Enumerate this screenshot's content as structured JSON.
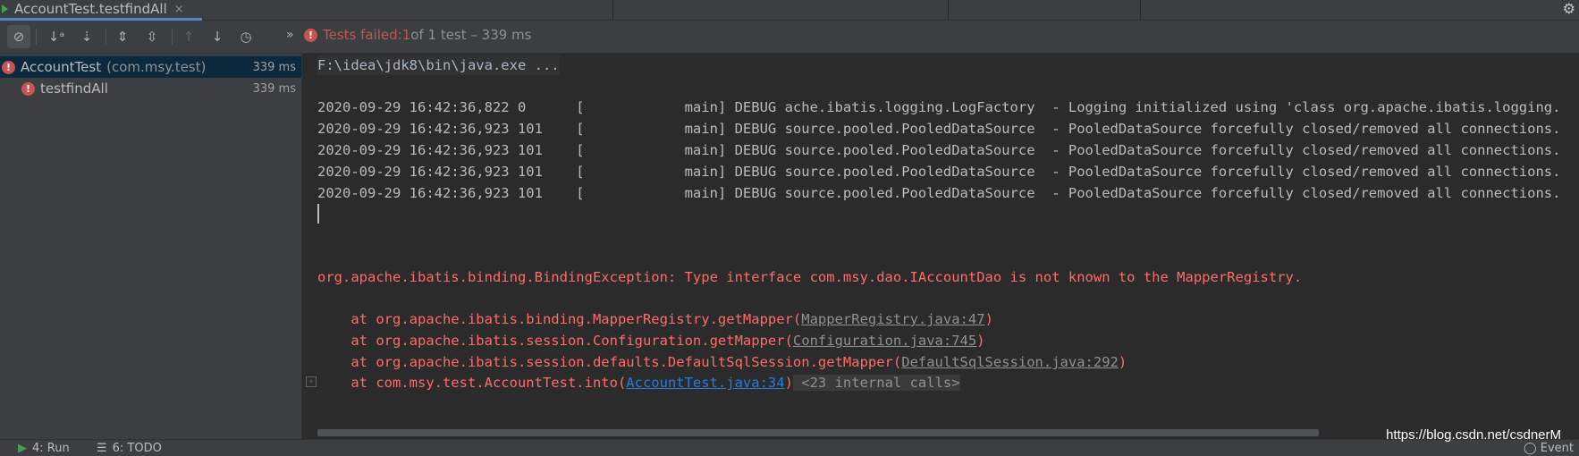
{
  "tab": {
    "title": "AccountTest.testfindAll",
    "close": "×"
  },
  "toolbar": {
    "status_prefix": "Tests failed: ",
    "failed_count": "1",
    "status_suffix": " of 1 test – 339 ms",
    "overflow": "»"
  },
  "tree": {
    "items": [
      {
        "name": "AccountTest",
        "package": "(com.msy.test)",
        "time": "339 ms"
      },
      {
        "name": "testfindAll",
        "time": "339 ms"
      }
    ]
  },
  "console": {
    "command": "F:\\idea\\jdk8\\bin\\java.exe ...",
    "log_lines": [
      "2020-09-29 16:42:36,822 0      [            main] DEBUG ache.ibatis.logging.LogFactory  - Logging initialized using 'class org.apache.ibatis.logging.",
      "2020-09-29 16:42:36,923 101    [            main] DEBUG source.pooled.PooledDataSource  - PooledDataSource forcefully closed/removed all connections.",
      "2020-09-29 16:42:36,923 101    [            main] DEBUG source.pooled.PooledDataSource  - PooledDataSource forcefully closed/removed all connections.",
      "2020-09-29 16:42:36,923 101    [            main] DEBUG source.pooled.PooledDataSource  - PooledDataSource forcefully closed/removed all connections.",
      "2020-09-29 16:42:36,923 101    [            main] DEBUG source.pooled.PooledDataSource  - PooledDataSource forcefully closed/removed all connections."
    ],
    "exception": "org.apache.ibatis.binding.BindingException: Type interface com.msy.dao.IAccountDao is not known to the MapperRegistry.",
    "stack": [
      {
        "prefix": "    at org.apache.ibatis.binding.MapperRegistry.getMapper(",
        "link": "MapperRegistry.java:47",
        "suffix": ")"
      },
      {
        "prefix": "    at org.apache.ibatis.session.Configuration.getMapper(",
        "link": "Configuration.java:745",
        "suffix": ")"
      },
      {
        "prefix": "    at org.apache.ibatis.session.defaults.DefaultSqlSession.getMapper(",
        "link": "DefaultSqlSession.java:292",
        "suffix": ")"
      },
      {
        "prefix": "    at com.msy.test.AccountTest.into(",
        "link": "AccountTest.java:34",
        "suffix": ")",
        "internal": " <23 internal calls>"
      }
    ]
  },
  "bottom": {
    "run_tab": "4: Run",
    "todo_tab": "6: TODO",
    "event": "Event",
    "watermark": "https://blog.csdn.net/csdnerM"
  },
  "colors": {
    "error": "#c75450",
    "accent": "#4a88c7",
    "link": "#287bde"
  }
}
